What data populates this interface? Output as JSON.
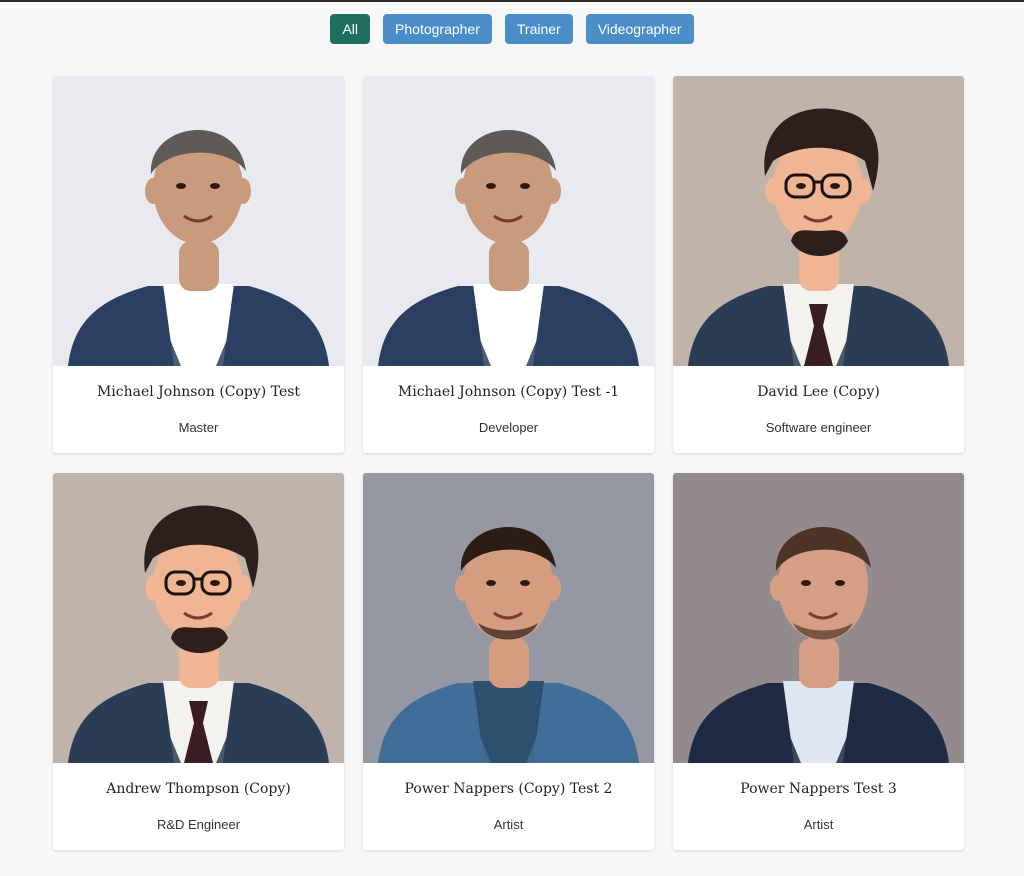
{
  "filters": [
    {
      "label": "All",
      "active": true
    },
    {
      "label": "Photographer",
      "active": false
    },
    {
      "label": "Trainer",
      "active": false
    },
    {
      "label": "Videographer",
      "active": false
    }
  ],
  "cards": [
    {
      "name": "Michael Johnson (Copy) Test",
      "role": "Master",
      "portrait": "photo",
      "bg": "#e8eaef",
      "skin": "#c99a7c",
      "hair": "#5e5a56",
      "suit": "#2b3f63",
      "shirt": "#ffffff"
    },
    {
      "name": "Michael Johnson (Copy) Test -1",
      "role": "Developer",
      "portrait": "photo",
      "bg": "#e8eaef",
      "skin": "#c99a7c",
      "hair": "#5e5a56",
      "suit": "#2b3f63",
      "shirt": "#ffffff"
    },
    {
      "name": "David Lee (Copy)",
      "role": "Software engineer",
      "portrait": "cartoon",
      "bg": "#bfb3aa",
      "skin": "#f0b593",
      "hair": "#2d1f1c",
      "suit": "#2a3d55",
      "shirt": "#f4f2ee"
    },
    {
      "name": "Andrew Thompson (Copy)",
      "role": "R&D Engineer",
      "portrait": "cartoon",
      "bg": "#bfb3aa",
      "skin": "#f0b593",
      "hair": "#2d1f1c",
      "suit": "#2a3d55",
      "shirt": "#f4f2ee"
    },
    {
      "name": "Power Nappers (Copy) Test 2",
      "role": "Artist",
      "portrait": "casual",
      "bg": "#9597a2",
      "skin": "#d69c80",
      "hair": "#2b1d16",
      "suit": "#3f6f98",
      "shirt": "#2f4f6f"
    },
    {
      "name": "Power Nappers Test 3",
      "role": "Artist",
      "portrait": "profile",
      "bg": "#938a8d",
      "skin": "#d59e85",
      "hair": "#4e3426",
      "suit": "#1f2b43",
      "shirt": "#dfe8f2"
    }
  ]
}
